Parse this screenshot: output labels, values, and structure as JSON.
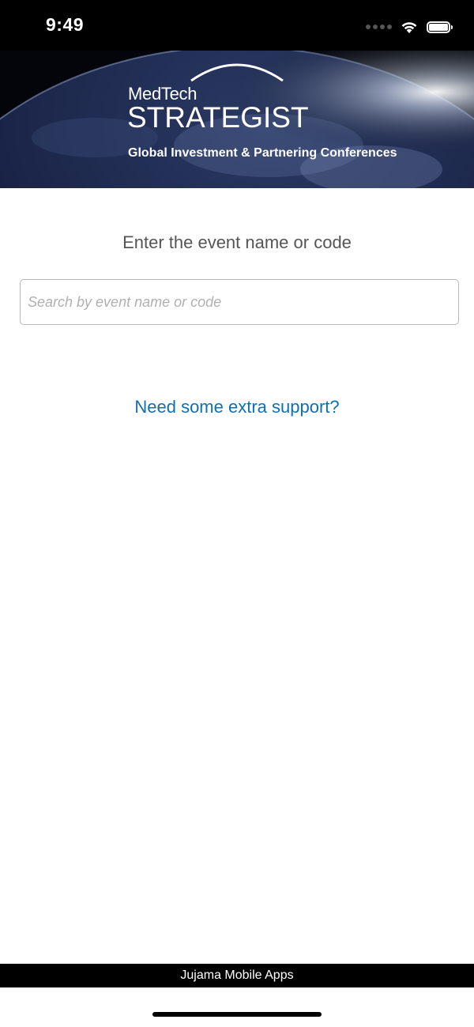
{
  "status_bar": {
    "time": "9:49"
  },
  "banner": {
    "brand_top": "MedTech",
    "brand_main": "STRATEGIST",
    "tagline": "Global Investment & Partnering Conferences"
  },
  "main": {
    "prompt": "Enter the event name or code",
    "search_placeholder": "Search by event name or code",
    "search_value": "",
    "support_link": "Need some extra support?"
  },
  "footer": {
    "label": "Jujama Mobile Apps"
  },
  "colors": {
    "link": "#0f6fb3",
    "prompt_text": "#555555",
    "bars": "#000000"
  }
}
